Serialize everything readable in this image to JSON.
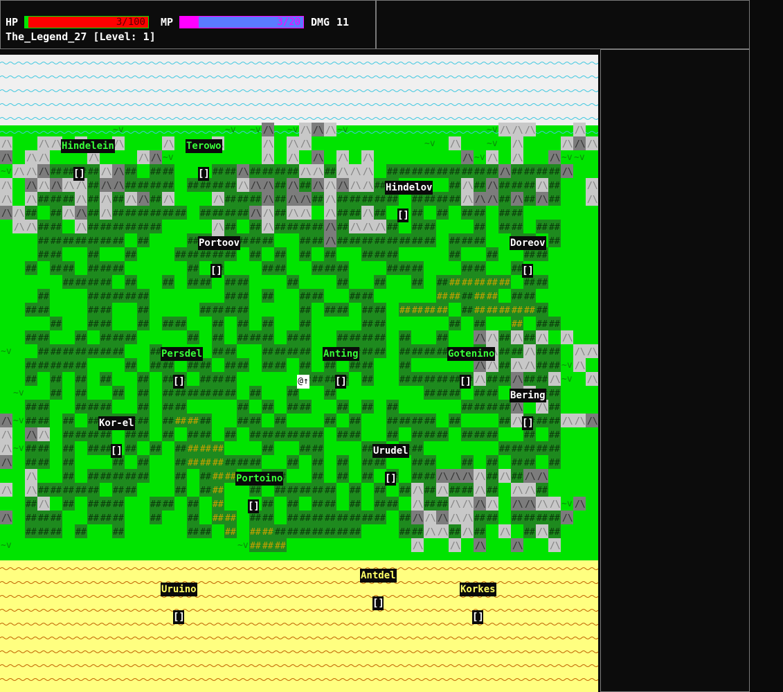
{
  "status": {
    "hp_label": "HP",
    "hp_text": "3/100",
    "hp_fraction": 0.03,
    "mp_label": "MP",
    "mp_text": "3/20",
    "mp_fraction": 0.15,
    "dmg_label": "DMG",
    "dmg_value": "11",
    "player_line": "The_Legend_27 [Level: 1]"
  },
  "colors": {
    "grass": "#00e400",
    "forest": "#1e8a1e",
    "mountain": "#c8c8c8",
    "mountain_dark": "#7c7c7c",
    "snow": "#f0f0f0",
    "sand": "#ffff80",
    "road": "#c8a000",
    "hp_fill": "#ff0000",
    "mp_fill": "#5a7bff",
    "mp_start": "#ff00ff"
  },
  "map": {
    "player_glyph": "@↑",
    "towns": [
      {
        "name": "Hindelein",
        "color": "#39ff39"
      },
      {
        "name": "Terowo",
        "color": "#39ff39"
      },
      {
        "name": "Hindelov",
        "color": "#ffffff"
      },
      {
        "name": "Portoov",
        "color": "#ffffff"
      },
      {
        "name": "Doreov",
        "color": "#ffffff"
      },
      {
        "name": "Persdel",
        "color": "#39ff39"
      },
      {
        "name": "Anting",
        "color": "#39ff39"
      },
      {
        "name": "Gotenino",
        "color": "#39ff39"
      },
      {
        "name": "Bering",
        "color": "#ffffff"
      },
      {
        "name": "Kor-el",
        "color": "#ffffff"
      },
      {
        "name": "Urudel",
        "color": "#ffffff"
      },
      {
        "name": "Portoino",
        "color": "#39ff39"
      },
      {
        "name": "Antdel",
        "color": "#ffff66"
      },
      {
        "name": "Uruino",
        "color": "#ffff66"
      },
      {
        "name": "Korkes",
        "color": "#ffff66"
      }
    ],
    "dungeon_glyph": "[]"
  }
}
